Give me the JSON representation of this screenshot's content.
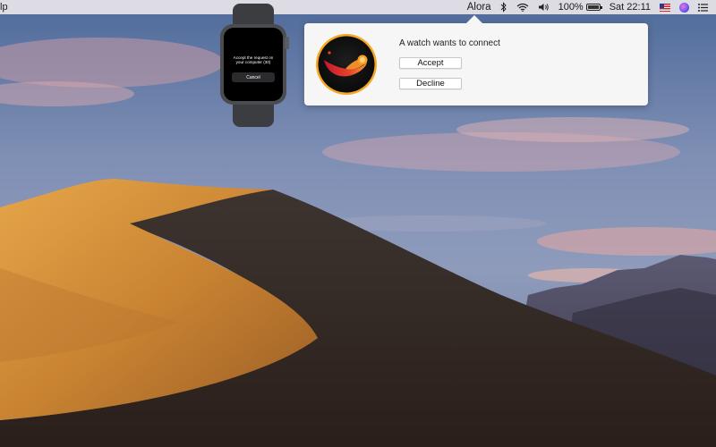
{
  "menubar": {
    "left_fragment": "lp",
    "app_name": "Alora",
    "battery_percent": "100%",
    "clock": "Sat 22:11",
    "icons": [
      "bluetooth-icon",
      "wifi-icon",
      "volume-icon",
      "battery-icon",
      "us-flag-icon",
      "siri-icon",
      "notification-center-icon"
    ]
  },
  "watch": {
    "message": "Accept the request on your computer (30)",
    "cancel_label": "Cancel"
  },
  "popover": {
    "title": "A watch wants to connect",
    "accept_label": "Accept",
    "decline_label": "Decline"
  },
  "colors": {
    "sky_top": "#3e5a8c",
    "dune_light": "#d9993f",
    "dune_shadow": "#3a2b22",
    "icon_ring": "#f5a623"
  }
}
